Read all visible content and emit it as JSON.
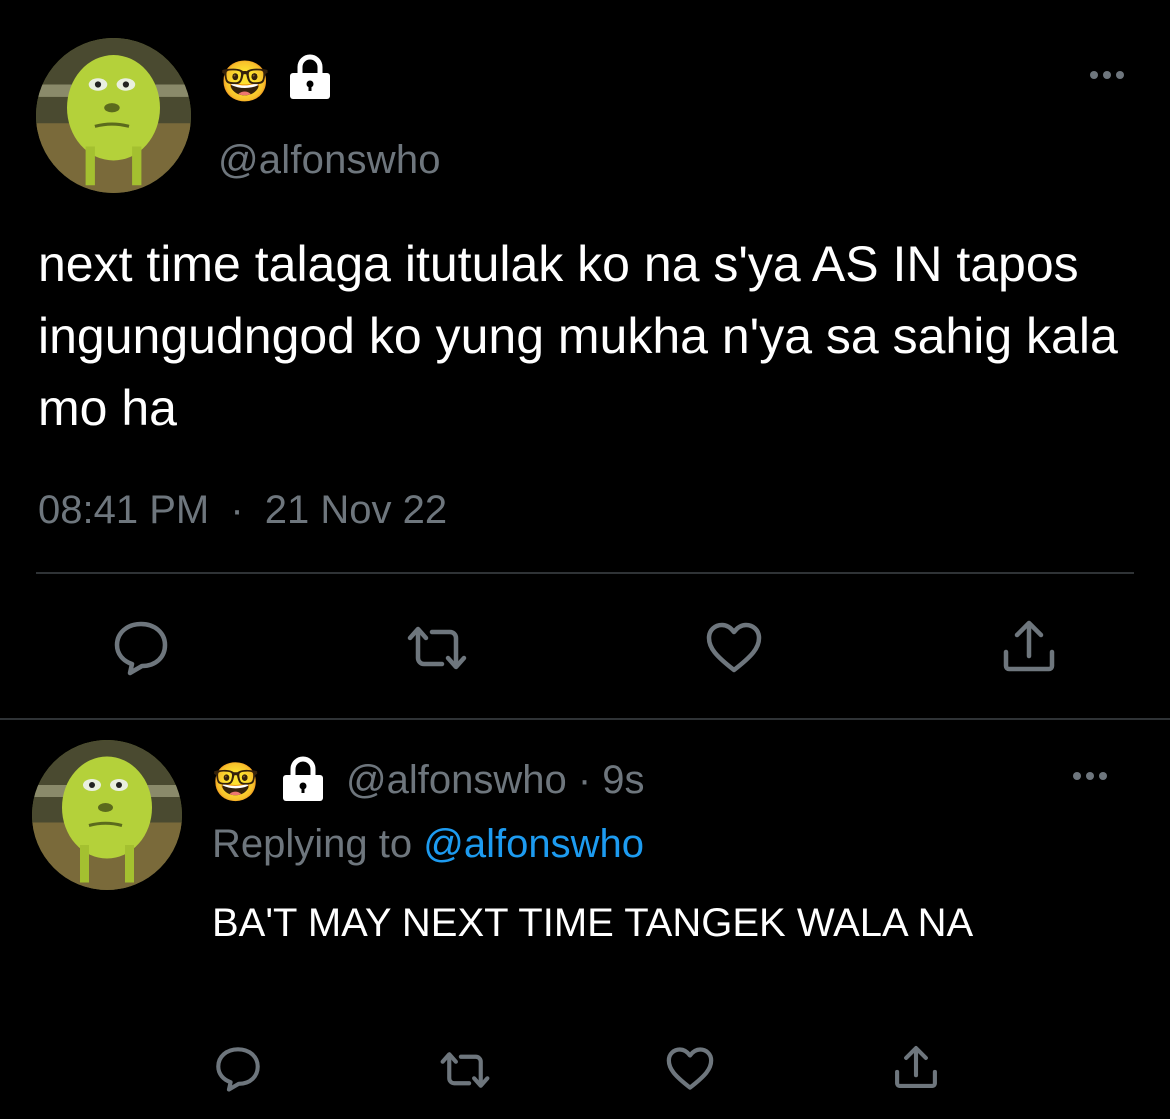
{
  "main_tweet": {
    "avatar": "avatar",
    "badge_emoji": "🤓",
    "lock_icon": "lock-icon",
    "handle": "@alfonswho",
    "more_icon": "more-icon",
    "text": "next time talaga itutulak ko na s'ya AS IN tapos ingungudngod ko yung mukha n'ya sa sahig kala mo ha",
    "time": "08:41 PM",
    "separator": "·",
    "date": "21 Nov 22",
    "actions": [
      "reply-icon",
      "retweet-icon",
      "like-icon",
      "share-icon"
    ]
  },
  "reply_tweet": {
    "avatar": "avatar",
    "badge_emoji": "🤓",
    "lock_icon": "lock-icon",
    "handle_and_time": "@alfonswho · 9s",
    "replying_prefix": "Replying to",
    "replying_to": "@alfonswho",
    "more_icon": "more-icon",
    "text": "BA'T MAY NEXT TIME TANGEK WALA NA",
    "actions": [
      "reply-icon",
      "retweet-icon",
      "like-icon",
      "share-icon"
    ]
  },
  "colors": {
    "background": "#000000",
    "text": "#ffffff",
    "secondary": "#6e767d",
    "link": "#1d9bf0",
    "divider": "#2f3336"
  }
}
